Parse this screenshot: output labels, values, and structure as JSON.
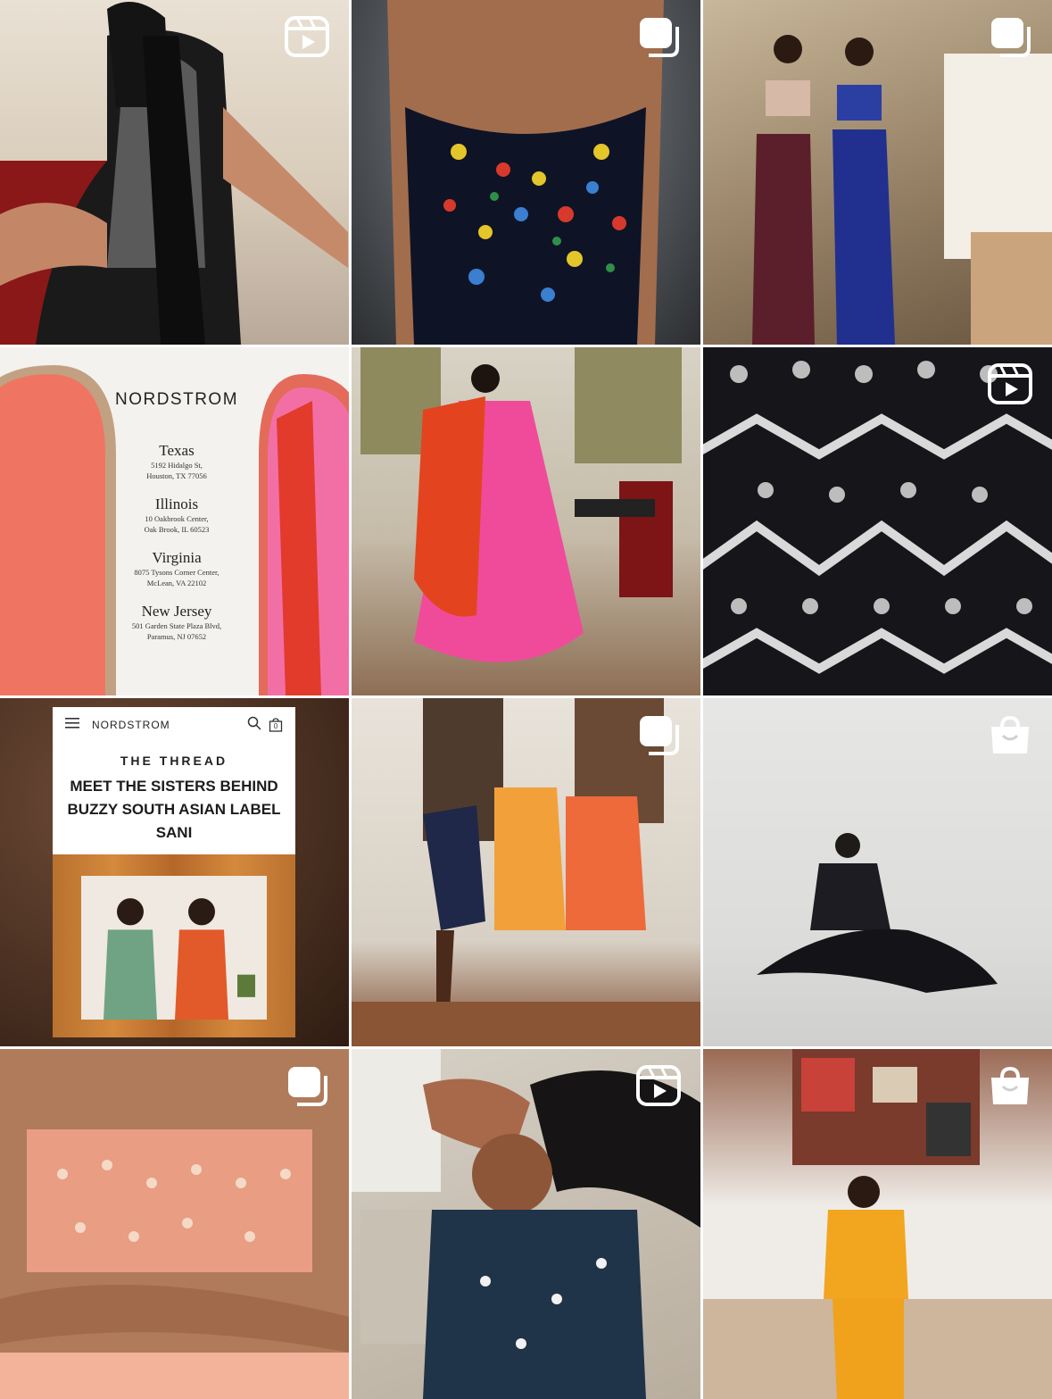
{
  "grid": {
    "tiles": [
      {
        "badge": "reel-icon"
      },
      {
        "badge": "carousel-icon"
      },
      {
        "badge": "carousel-icon"
      },
      {
        "badge": null,
        "brand": "NORDSTROM",
        "stores": [
          {
            "state": "Texas",
            "address1": "5192 Hidalgo St,",
            "address2": "Houston, TX 77056"
          },
          {
            "state": "Illinois",
            "address1": "10 Oakbrook Center,",
            "address2": "Oak Brook, IL 60523"
          },
          {
            "state": "Virginia",
            "address1": "8075 Tysons Corner Center,",
            "address2": "McLean, VA 22102"
          },
          {
            "state": "New Jersey",
            "address1": "501 Garden State Plaza Blvd,",
            "address2": "Paramus, NJ 07652"
          }
        ]
      },
      {
        "badge": null
      },
      {
        "badge": "reel-icon"
      },
      {
        "badge": null,
        "brand": "NORDSTROM",
        "bag_count": "0",
        "kicker": "THE THREAD",
        "headline": "MEET THE SISTERS BEHIND BUZZY SOUTH ASIAN LABEL SANI"
      },
      {
        "badge": "carousel-icon"
      },
      {
        "badge": "shopping-bag-icon"
      },
      {
        "badge": "carousel-icon"
      },
      {
        "badge": "reel-icon"
      },
      {
        "badge": "shopping-bag-icon"
      }
    ]
  },
  "colors": {
    "background": "#ffffff",
    "badge": "#ffffff"
  }
}
